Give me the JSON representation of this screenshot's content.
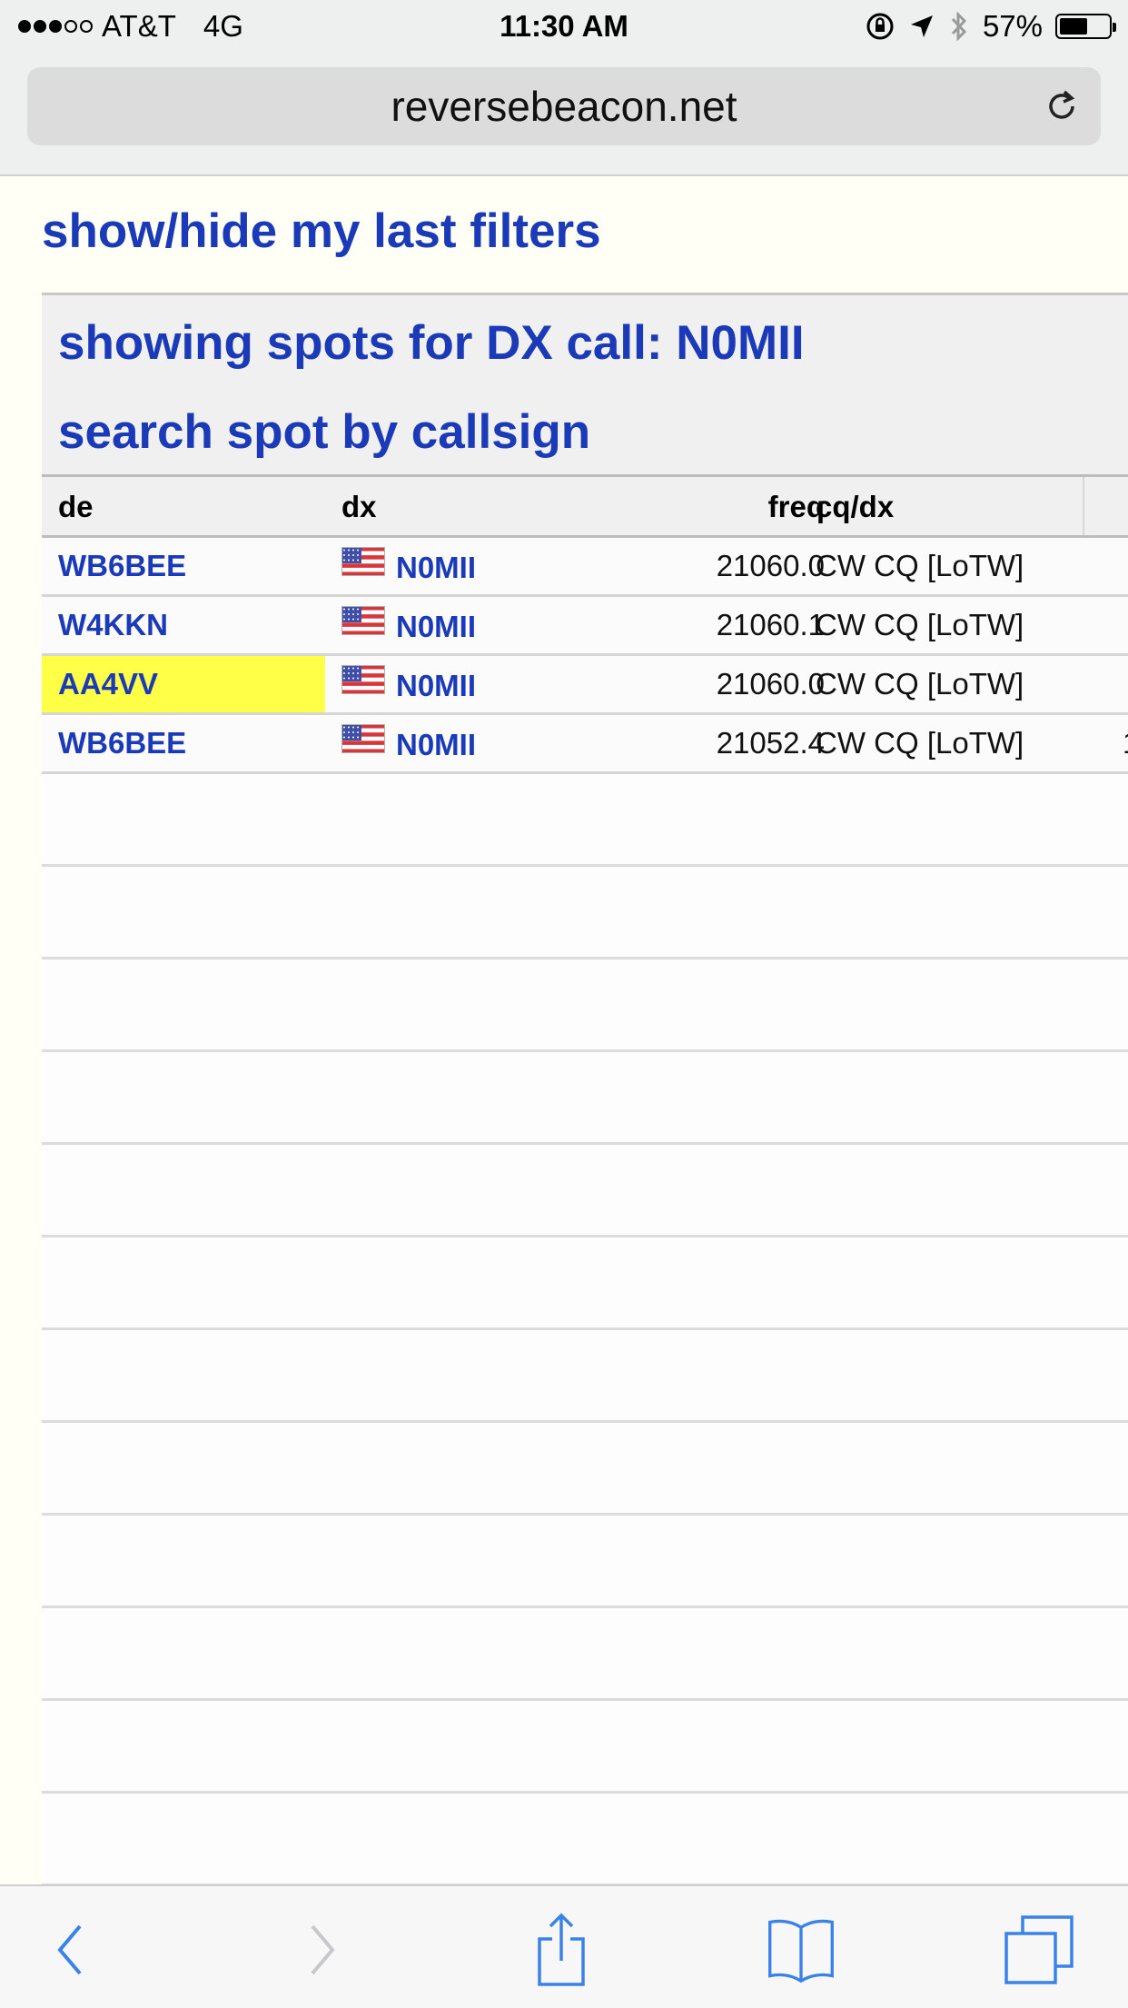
{
  "status": {
    "carrier": "AT&T",
    "network": "4G",
    "time": "11:30 AM",
    "battery": "57%",
    "signal_bars_filled": 3,
    "signal_bars_total": 5,
    "battery_level": 0.57,
    "icons": [
      "rotation-lock-icon",
      "location-arrow-icon",
      "bluetooth-icon",
      "battery-icon"
    ]
  },
  "browser": {
    "url": "reversebeacon.net",
    "toolbar_icons": [
      "back-icon",
      "forward-icon",
      "share-icon",
      "bookmarks-icon",
      "tabs-icon"
    ]
  },
  "page": {
    "filters_link": "show/hide my last filters",
    "showing_spots": "showing spots for DX call: N0MII",
    "search_link": "search spot by callsign"
  },
  "table": {
    "headers": {
      "de": "de",
      "dx": "dx",
      "freq": "freq",
      "cqdx": "cq/dx"
    },
    "rows": [
      {
        "de": "WB6BEE",
        "dx": "N0MII",
        "freq": "21060.0",
        "cqdx": "CW CQ [LoTW]",
        "edge": "",
        "highlight": false
      },
      {
        "de": "W4KKN",
        "dx": "N0MII",
        "freq": "21060.1",
        "cqdx": "CW CQ [LoTW]",
        "edge": "",
        "highlight": false
      },
      {
        "de": "AA4VV",
        "dx": "N0MII",
        "freq": "21060.0",
        "cqdx": "CW CQ [LoTW]",
        "edge": "",
        "highlight": true
      },
      {
        "de": "WB6BEE",
        "dx": "N0MII",
        "freq": "21052.4",
        "cqdx": "CW CQ [LoTW]",
        "edge": "1",
        "highlight": false
      }
    ],
    "empty_rows": 12
  },
  "colors": {
    "link": "#1b3ab7",
    "highlight": "#ffff47",
    "ios_blue": "#3a82e8",
    "disabled": "#c7c7cc"
  }
}
